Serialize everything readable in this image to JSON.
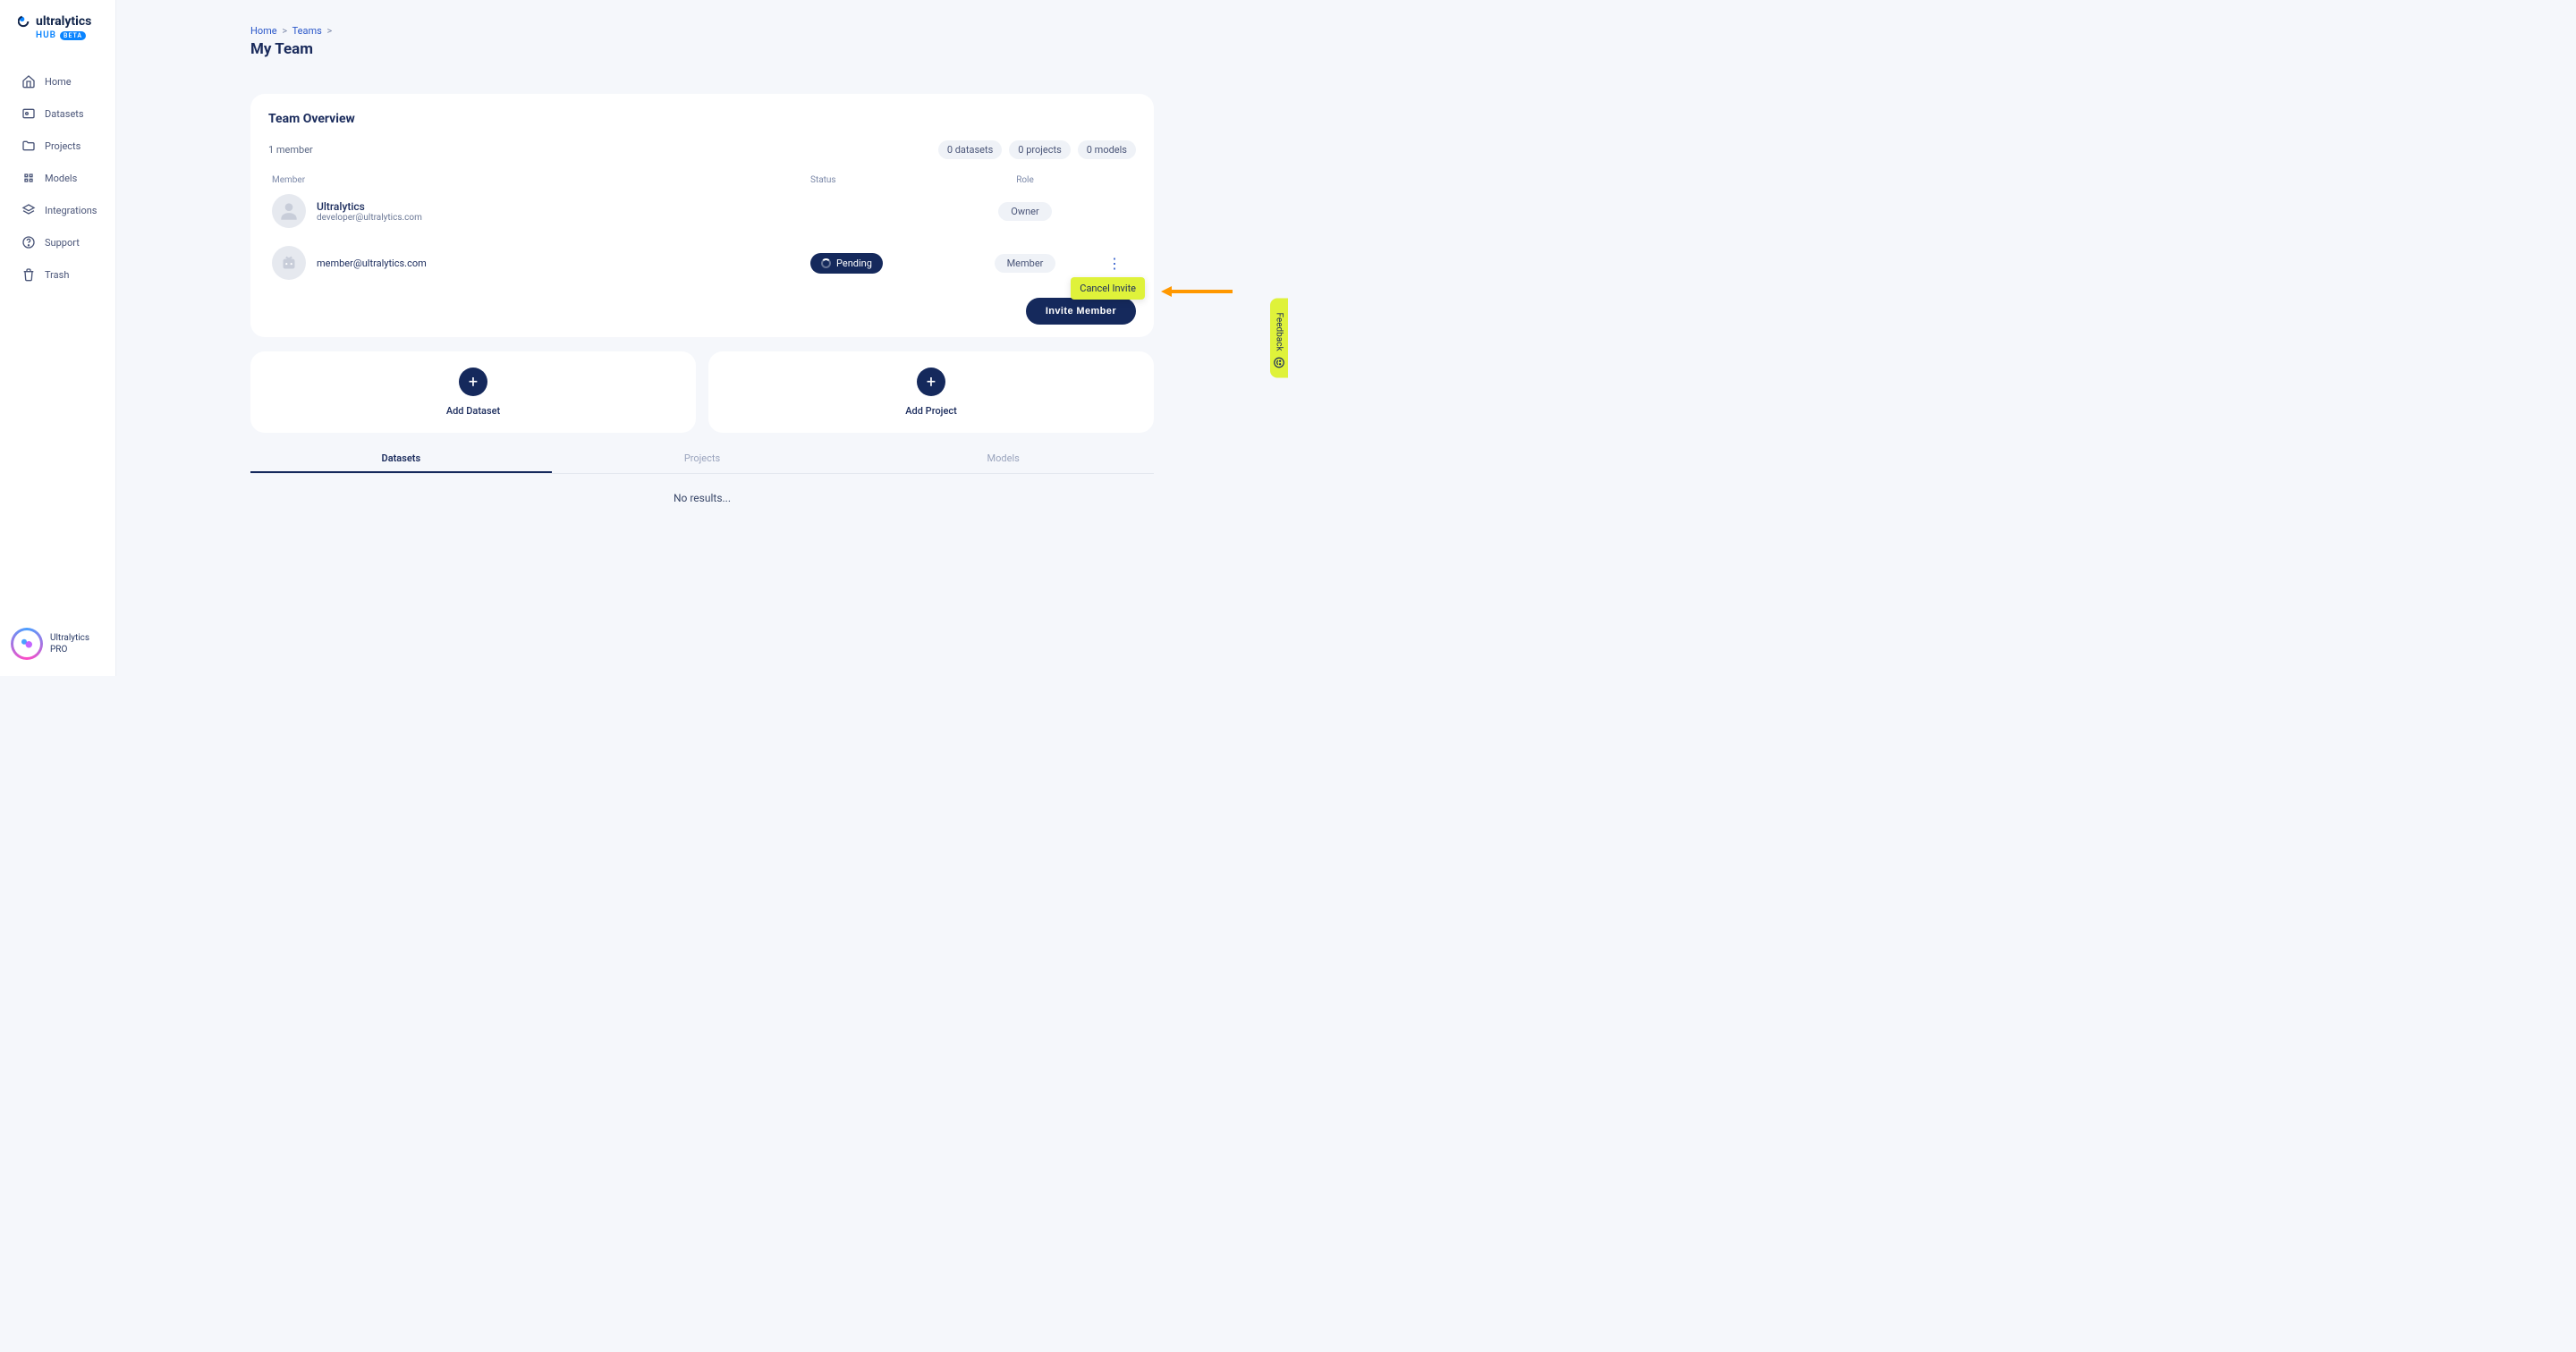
{
  "brand": {
    "name": "ultralytics",
    "hub": "HUB",
    "beta": "BETA"
  },
  "sidebar": {
    "items": [
      {
        "label": "Home"
      },
      {
        "label": "Datasets"
      },
      {
        "label": "Projects"
      },
      {
        "label": "Models"
      },
      {
        "label": "Integrations"
      },
      {
        "label": "Support"
      },
      {
        "label": "Trash"
      }
    ],
    "user": {
      "name": "Ultralytics",
      "plan": "PRO"
    }
  },
  "breadcrumb": {
    "home": "Home",
    "teams": "Teams"
  },
  "page": {
    "title": "My Team"
  },
  "overview": {
    "heading": "Team Overview",
    "member_count": "1 member",
    "stats": {
      "datasets": "0 datasets",
      "projects": "0 projects",
      "models": "0 models"
    },
    "columns": {
      "member": "Member",
      "status": "Status",
      "role": "Role"
    },
    "members": [
      {
        "name": "Ultralytics",
        "email": "developer@ultralytics.com",
        "status": "",
        "role": "Owner",
        "has_menu": false
      },
      {
        "name": "",
        "email": "member@ultralytics.com",
        "status": "Pending",
        "role": "Member",
        "has_menu": true
      }
    ],
    "invite_label": "Invite Member",
    "popover": {
      "cancel_invite": "Cancel Invite"
    }
  },
  "add": {
    "dataset": "Add Dataset",
    "project": "Add Project"
  },
  "tabs": {
    "datasets": "Datasets",
    "projects": "Projects",
    "models": "Models"
  },
  "empty": {
    "no_results": "No results..."
  },
  "feedback": {
    "label": "Feedback"
  }
}
